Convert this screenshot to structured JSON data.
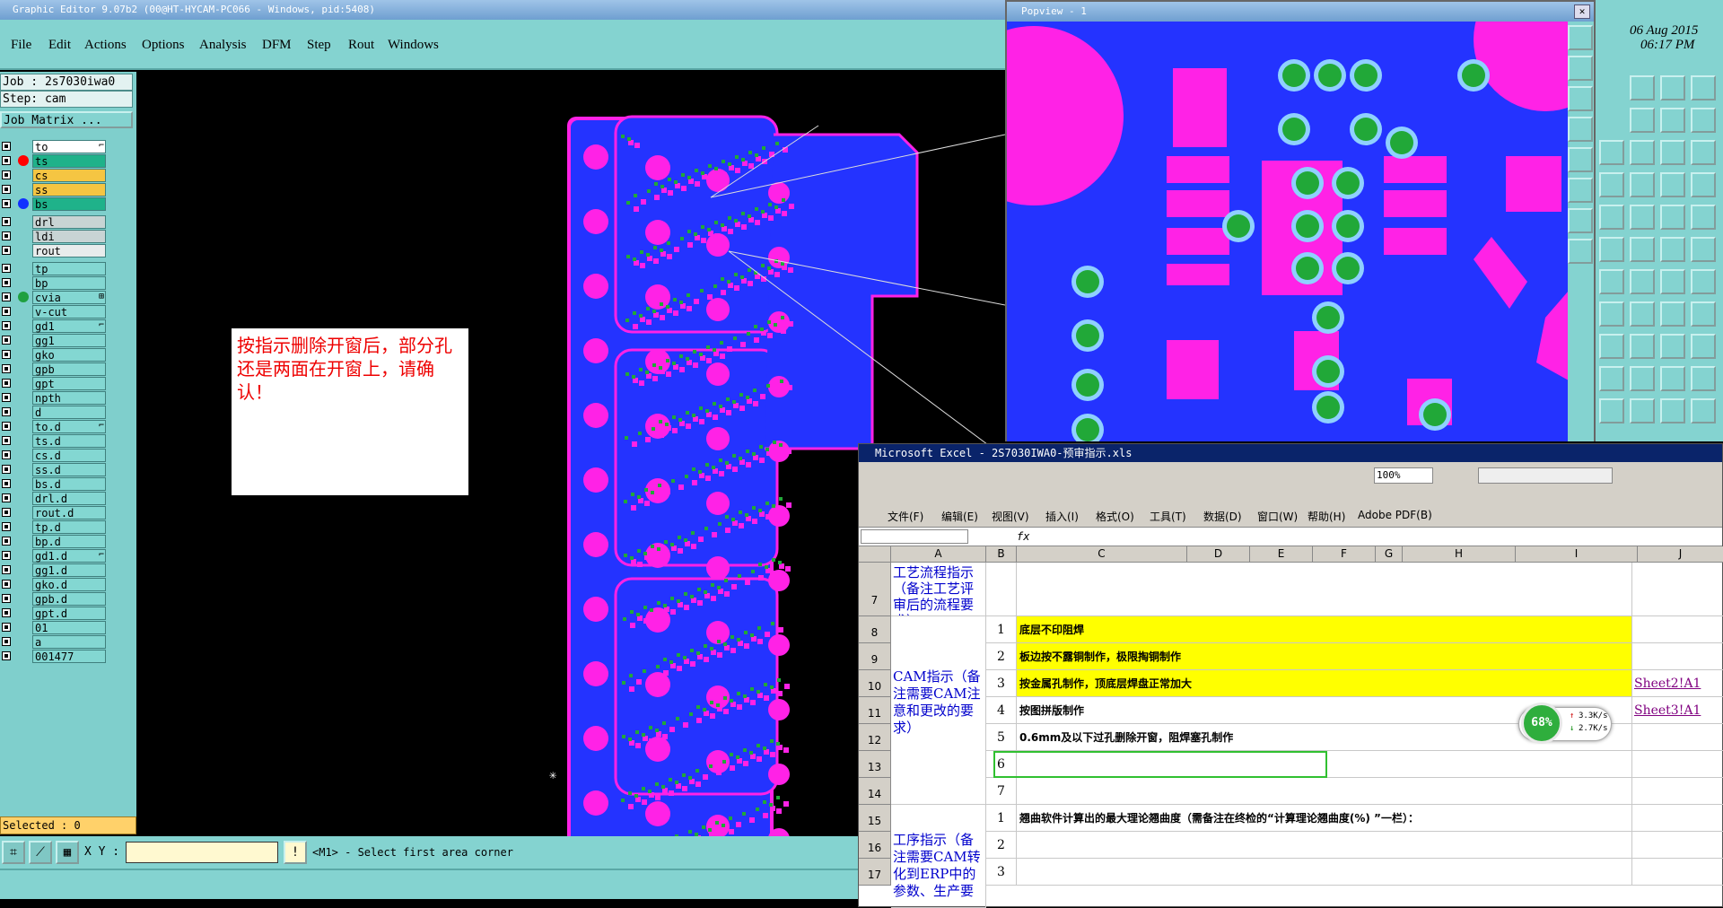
{
  "app": {
    "title": "Graphic Editor 9.07b2 (00@HT-HYCAM-PC066 - Windows, pid:5408)",
    "menu": [
      "File",
      "Edit",
      "Actions",
      "Options",
      "Analysis",
      "DFM",
      "Step",
      "Rout",
      "Windows"
    ]
  },
  "left": {
    "job": "Job : 2s7030iwa0",
    "step": "Step: cam",
    "matrix_button": "Job Matrix ...",
    "layers": [
      {
        "name": "to",
        "bg": "#ffffff",
        "dot": "",
        "mark": "⌐"
      },
      {
        "name": "ts",
        "bg": "#1fb28a",
        "dot": "#ff0000",
        "mark": ""
      },
      {
        "name": "cs",
        "bg": "#f5c542",
        "dot": "",
        "mark": ""
      },
      {
        "name": "ss",
        "bg": "#f5c542",
        "dot": "",
        "mark": ""
      },
      {
        "name": "bs",
        "bg": "#1fb28a",
        "dot": "#1030ff",
        "mark": ""
      },
      {
        "name": "drl",
        "bg": "#c8d4d4",
        "dot": "",
        "mark": ""
      },
      {
        "name": "ldi",
        "bg": "#c8d4d4",
        "dot": "",
        "mark": ""
      },
      {
        "name": "rout",
        "bg": "#e8ecec",
        "dot": "",
        "mark": ""
      },
      {
        "name": "tp",
        "bg": "#83d7d2",
        "dot": "",
        "mark": ""
      },
      {
        "name": "bp",
        "bg": "#83d7d2",
        "dot": "",
        "mark": ""
      },
      {
        "name": "cvia",
        "bg": "#83d7d2",
        "dot": "#1fa040",
        "mark": "⊞"
      },
      {
        "name": "v-cut",
        "bg": "#83d7d2",
        "dot": "",
        "mark": ""
      },
      {
        "name": "gd1",
        "bg": "#83d7d2",
        "dot": "",
        "mark": "⌐"
      },
      {
        "name": "gg1",
        "bg": "#83d7d2",
        "dot": "",
        "mark": ""
      },
      {
        "name": "gko",
        "bg": "#83d7d2",
        "dot": "",
        "mark": ""
      },
      {
        "name": "gpb",
        "bg": "#83d7d2",
        "dot": "",
        "mark": ""
      },
      {
        "name": "gpt",
        "bg": "#83d7d2",
        "dot": "",
        "mark": ""
      },
      {
        "name": "npth",
        "bg": "#83d7d2",
        "dot": "",
        "mark": ""
      },
      {
        "name": "d",
        "bg": "#83d7d2",
        "dot": "",
        "mark": ""
      },
      {
        "name": "to.d",
        "bg": "#83d7d2",
        "dot": "",
        "mark": "⌐"
      },
      {
        "name": "ts.d",
        "bg": "#83d7d2",
        "dot": "",
        "mark": ""
      },
      {
        "name": "cs.d",
        "bg": "#83d7d2",
        "dot": "",
        "mark": ""
      },
      {
        "name": "ss.d",
        "bg": "#83d7d2",
        "dot": "",
        "mark": ""
      },
      {
        "name": "bs.d",
        "bg": "#83d7d2",
        "dot": "",
        "mark": ""
      },
      {
        "name": "drl.d",
        "bg": "#83d7d2",
        "dot": "",
        "mark": ""
      },
      {
        "name": "rout.d",
        "bg": "#83d7d2",
        "dot": "",
        "mark": ""
      },
      {
        "name": "tp.d",
        "bg": "#83d7d2",
        "dot": "",
        "mark": ""
      },
      {
        "name": "bp.d",
        "bg": "#83d7d2",
        "dot": "",
        "mark": ""
      },
      {
        "name": "gd1.d",
        "bg": "#83d7d2",
        "dot": "",
        "mark": "⌐"
      },
      {
        "name": "gg1.d",
        "bg": "#83d7d2",
        "dot": "",
        "mark": ""
      },
      {
        "name": "gko.d",
        "bg": "#83d7d2",
        "dot": "",
        "mark": ""
      },
      {
        "name": "gpb.d",
        "bg": "#83d7d2",
        "dot": "",
        "mark": ""
      },
      {
        "name": "gpt.d",
        "bg": "#83d7d2",
        "dot": "",
        "mark": ""
      },
      {
        "name": "01",
        "bg": "#83d7d2",
        "dot": "",
        "mark": ""
      },
      {
        "name": "a",
        "bg": "#83d7d2",
        "dot": "",
        "mark": ""
      },
      {
        "name": "001477",
        "bg": "#83d7d2",
        "dot": "",
        "mark": ""
      }
    ],
    "selected": "Selected : 0"
  },
  "canvas": {
    "note_text": "按指示删除开窗后，部分孔还是两面在开窗上，请确认！",
    "colors": {
      "board": "#2433ff",
      "pad": "#ff22e6",
      "via": "#21a838",
      "ring": "#8fd0ff"
    }
  },
  "bottom": {
    "xy_label": "X Y :",
    "xy_value": "",
    "prompt": "<M1> - Select first area corner"
  },
  "popview": {
    "title": "Popview - 1",
    "date": "06 Aug 2015",
    "time": "06:17 PM"
  },
  "excel": {
    "title": "Microsoft Excel - 2S7030IWA0-预审指示.xls",
    "zoom": "100%",
    "menu": [
      "文件(F)",
      "编辑(E)",
      "视图(V)",
      "插入(I)",
      "格式(O)",
      "工具(T)",
      "数据(D)",
      "窗口(W)",
      "帮助(H)",
      "Adobe PDF(B)"
    ],
    "columns": [
      "A",
      "B",
      "C",
      "D",
      "E",
      "F",
      "G",
      "H",
      "I",
      "J"
    ],
    "rows": [
      {
        "num": "7",
        "a": "工艺流程指示（备注工艺评审后的流程要求）",
        "b": "",
        "c": "",
        "yellow": false,
        "j": ""
      },
      {
        "num": "8",
        "a": "",
        "b": "1",
        "c": "底层不印阻焊",
        "yellow": true,
        "j": ""
      },
      {
        "num": "9",
        "a": "",
        "b": "2",
        "c": "板边按不露铜制作，极限掏铜制作",
        "yellow": true,
        "j": ""
      },
      {
        "num": "10",
        "a": "",
        "b": "3",
        "c": "按金属孔制作，顶底层焊盘正常加大",
        "yellow": true,
        "j": "Sheet2!A1"
      },
      {
        "num": "11",
        "a": "",
        "b": "4",
        "c": "按图拼版制作",
        "yellow": false,
        "j": "Sheet3!A1"
      },
      {
        "num": "12",
        "a": "",
        "b": "5",
        "c": "0.6mm及以下过孔删除开窗，阻焊塞孔制作",
        "yellow": false,
        "j": ""
      },
      {
        "num": "13",
        "a": "",
        "b": "6",
        "c": "",
        "yellow": false,
        "j": ""
      },
      {
        "num": "14",
        "a": "",
        "b": "7",
        "c": "",
        "yellow": false,
        "j": ""
      },
      {
        "num": "15",
        "a": "",
        "b": "1",
        "c": "翘曲软件计算出的最大理论翘曲度（需备注在终检的“计算理论翘曲度(%) ”一栏）：",
        "yellow": false,
        "j": ""
      },
      {
        "num": "16",
        "a": "",
        "b": "2",
        "c": "",
        "yellow": false,
        "j": ""
      },
      {
        "num": "17",
        "a": "",
        "b": "3",
        "c": "",
        "yellow": false,
        "j": ""
      }
    ],
    "cam_label": "CAM指示（备注需要CAM注意和更改的要求）",
    "process_label": "工序指示（备注需要CAM转化到ERP中的参数、生产要",
    "fx": "fx"
  },
  "gauge": {
    "percent": "68%",
    "up": "3.3K/s",
    "down": "2.7K/s"
  }
}
